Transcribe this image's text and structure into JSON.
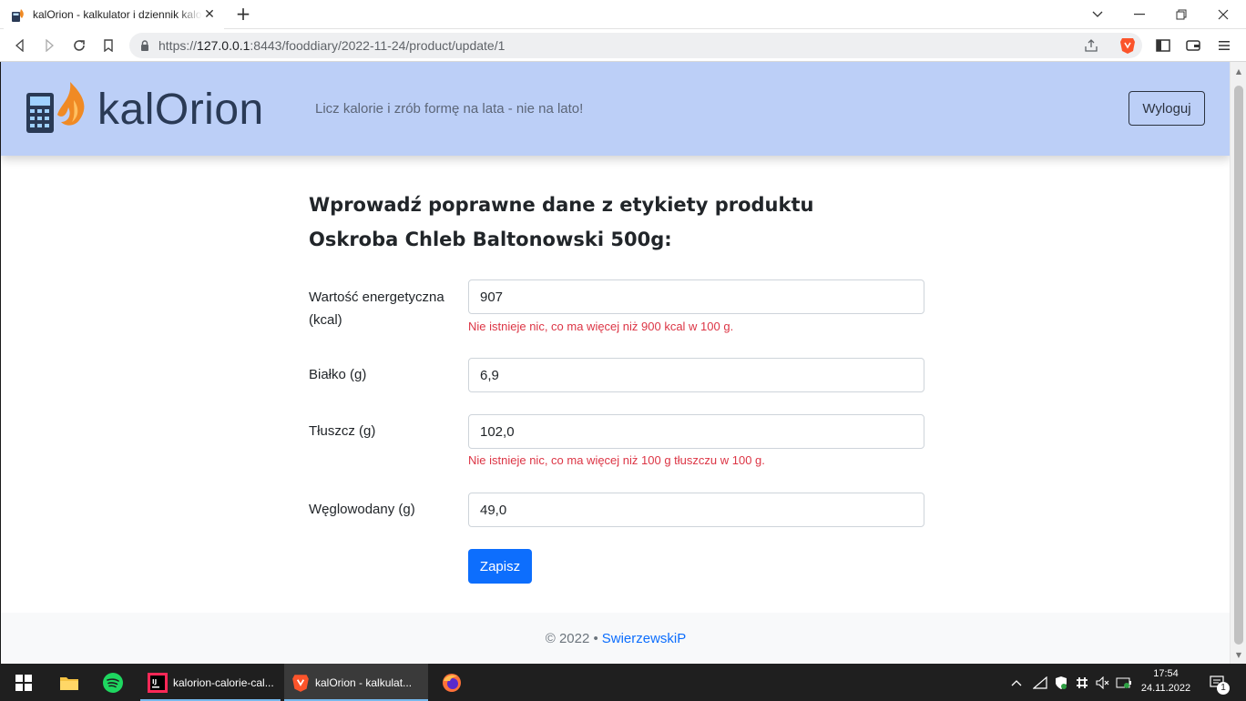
{
  "browser": {
    "tab_title": "kalOrion - kalkulator i dziennik kalorii",
    "tab_close": "✕",
    "new_tab": "+",
    "url_scheme": "https://",
    "url_host": "127.0.0.1",
    "url_rest": ":8443/fooddiary/2022-11-24/product/update/1"
  },
  "header": {
    "app_name": "kalOrion",
    "tagline": "Licz kalorie i zrób formę na lata - nie na lato!",
    "logout_label": "Wyloguj"
  },
  "form": {
    "title_line1": "Wprowadź poprawne dane z etykiety produktu",
    "title_line2": "Oskroba Chleb Baltonowski 500g:",
    "fields": [
      {
        "label": "Wartość energetyczna (kcal)",
        "value": "907",
        "error": "Nie istnieje nic, co ma więcej niż 900 kcal w 100 g."
      },
      {
        "label": "Białko (g)",
        "value": "6,9",
        "error": ""
      },
      {
        "label": "Tłuszcz (g)",
        "value": "102,0",
        "error": "Nie istnieje nic, co ma więcej niż 100 g tłuszczu w 100 g."
      },
      {
        "label": "Węglowodany (g)",
        "value": "49,0",
        "error": ""
      }
    ],
    "submit_label": "Zapisz"
  },
  "footer": {
    "copyright": "© 2022 •",
    "author": "SwierzewskiP"
  },
  "taskbar": {
    "apps": [
      {
        "label": "kalorion-calorie-cal..."
      },
      {
        "label": "kalOrion - kalkulat..."
      }
    ],
    "time": "17:54",
    "date": "24.11.2022",
    "notification_count": "1"
  },
  "colors": {
    "header_bg": "#bccff7",
    "primary": "#0d6efd",
    "error": "#dc3545"
  }
}
